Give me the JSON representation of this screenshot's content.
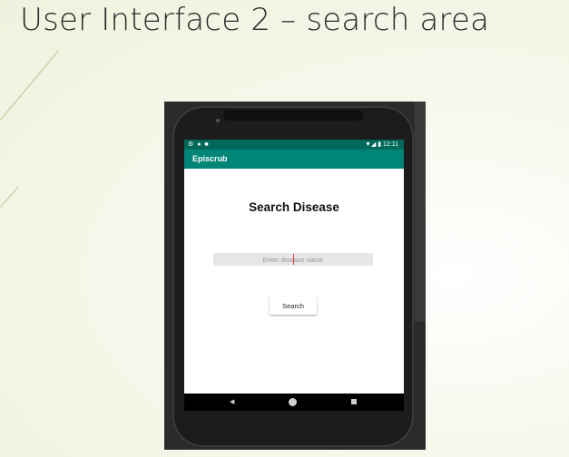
{
  "slide": {
    "title": "User Interface 2 – search area"
  },
  "phone": {
    "status_bar": {
      "left_icons": "⚙ ● ■",
      "right_icons": "▼◢ ▮",
      "time": "12:11"
    },
    "app_bar": {
      "title": "Episcrub"
    },
    "screen": {
      "heading": "Search Disease",
      "search_placeholder": "Enter disease name",
      "search_button_label": "Search"
    },
    "nav_bar": {
      "back_icon": "◀",
      "home_icon": "home-circle",
      "recents_icon": "recents-square"
    }
  },
  "colors": {
    "status_bar": "#00695c",
    "app_bar": "#008577"
  }
}
